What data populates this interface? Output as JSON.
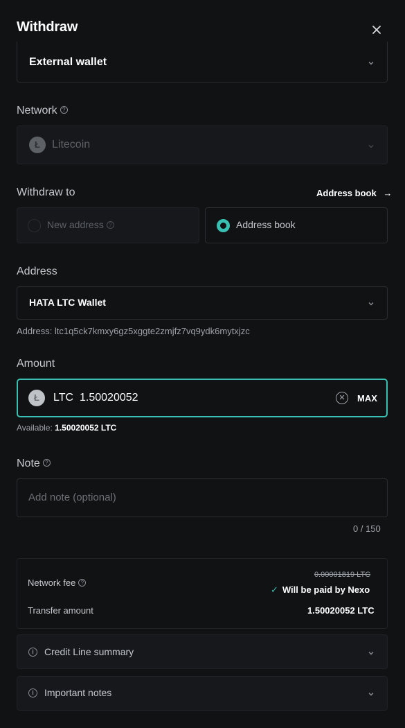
{
  "header": {
    "title": "Withdraw",
    "close_icon": "close-icon"
  },
  "destination": {
    "value": "External wallet"
  },
  "network": {
    "label": "Network",
    "value": "Litecoin"
  },
  "withdraw_to": {
    "label": "Withdraw to",
    "address_book_link": "Address book",
    "options": [
      {
        "label": "New address",
        "selected": false
      },
      {
        "label": "Address book",
        "selected": true
      }
    ]
  },
  "address": {
    "label": "Address",
    "selected": "HATA LTC Wallet",
    "detail": "Address: ltc1q5ck7kmxy6gz5xggte2zmjfz7vq9ydk6mytxjzc"
  },
  "amount": {
    "label": "Amount",
    "currency": "LTC",
    "value": "1.50020052",
    "max_label": "MAX",
    "available_label": "Available:",
    "available_value": "1.50020052 LTC"
  },
  "note": {
    "label": "Note",
    "placeholder": "Add note (optional)",
    "counter": "0 / 150"
  },
  "summary": {
    "network_fee_label": "Network fee",
    "network_fee_original": "0.00001819 LTC",
    "network_fee_paid": "Will be paid by Nexo",
    "transfer_label": "Transfer amount",
    "transfer_value": "1.50020052 LTC"
  },
  "accordions": [
    {
      "label": "Credit Line summary"
    },
    {
      "label": "Important notes"
    }
  ],
  "colors": {
    "accent": "#38c1b2",
    "background": "#111214"
  }
}
